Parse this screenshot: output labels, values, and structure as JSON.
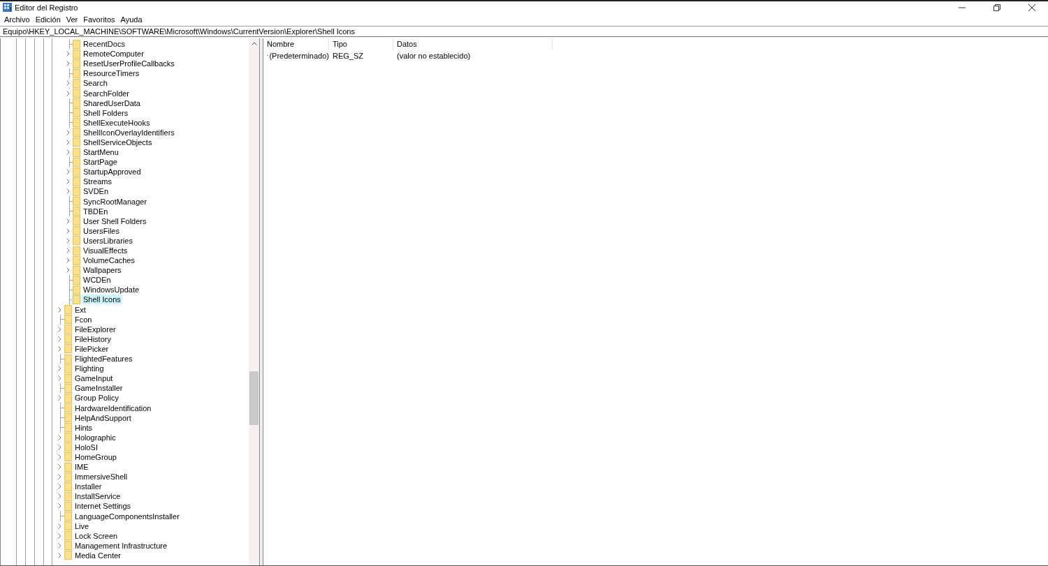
{
  "window": {
    "title": "Editor del Registro"
  },
  "menu": [
    "Archivo",
    "Edición",
    "Ver",
    "Favoritos",
    "Ayuda"
  ],
  "address": {
    "value": "Equipo\\HKEY_LOCAL_MACHINE\\SOFTWARE\\Microsoft\\Windows\\CurrentVersion\\Explorer\\Shell Icons"
  },
  "tree": {
    "items": [
      {
        "children": [
          {
            "label": "RecentDocs",
            "expandable": false,
            "selected": false
          },
          {
            "label": "RemoteComputer",
            "expandable": true,
            "selected": false
          },
          {
            "label": "ResetUserProfileCallbacks",
            "expandable": true,
            "selected": false
          },
          {
            "label": "ResourceTimers",
            "expandable": false,
            "selected": false
          },
          {
            "label": "Search",
            "expandable": true,
            "selected": false
          },
          {
            "label": "SearchFolder",
            "expandable": true,
            "selected": false
          },
          {
            "label": "SharedUserData",
            "expandable": false,
            "selected": false
          },
          {
            "label": "Shell Folders",
            "expandable": false,
            "selected": false
          },
          {
            "label": "ShellExecuteHooks",
            "expandable": false,
            "selected": false
          },
          {
            "label": "ShellIconOverlayIdentifiers",
            "expandable": true,
            "selected": false
          },
          {
            "label": "ShellServiceObjects",
            "expandable": true,
            "selected": false
          },
          {
            "label": "StartMenu",
            "expandable": true,
            "selected": false
          },
          {
            "label": "StartPage",
            "expandable": false,
            "selected": false
          },
          {
            "label": "StartupApproved",
            "expandable": true,
            "selected": false
          },
          {
            "label": "Streams",
            "expandable": true,
            "selected": false
          },
          {
            "label": "SVDEn",
            "expandable": true,
            "selected": false
          },
          {
            "label": "SyncRootManager",
            "expandable": false,
            "selected": false
          },
          {
            "label": "TBDEn",
            "expandable": false,
            "selected": false
          },
          {
            "label": "User Shell Folders",
            "expandable": true,
            "selected": false
          },
          {
            "label": "UsersFiles",
            "expandable": true,
            "selected": false
          },
          {
            "label": "UsersLibraries",
            "expandable": true,
            "selected": false
          },
          {
            "label": "VisualEffects",
            "expandable": true,
            "selected": false
          },
          {
            "label": "VolumeCaches",
            "expandable": true,
            "selected": false
          },
          {
            "label": "Wallpapers",
            "expandable": true,
            "selected": false
          },
          {
            "label": "WCDEn",
            "expandable": false,
            "selected": false
          },
          {
            "label": "WindowsUpdate",
            "expandable": false,
            "selected": false
          },
          {
            "label": "Shell Icons",
            "expandable": false,
            "selected": true
          }
        ]
      },
      {
        "label": "Ext",
        "expandable": true,
        "selected": false
      },
      {
        "label": "Fcon",
        "expandable": false,
        "selected": false
      },
      {
        "label": "FileExplorer",
        "expandable": true,
        "selected": false
      },
      {
        "label": "FileHistory",
        "expandable": true,
        "selected": false
      },
      {
        "label": "FilePicker",
        "expandable": true,
        "selected": false
      },
      {
        "label": "FlightedFeatures",
        "expandable": false,
        "selected": false
      },
      {
        "label": "Flighting",
        "expandable": true,
        "selected": false
      },
      {
        "label": "GameInput",
        "expandable": true,
        "selected": false
      },
      {
        "label": "GameInstaller",
        "expandable": false,
        "selected": false
      },
      {
        "label": "Group Policy",
        "expandable": true,
        "selected": false
      },
      {
        "label": "HardwareIdentification",
        "expandable": false,
        "selected": false
      },
      {
        "label": "HelpAndSupport",
        "expandable": false,
        "selected": false
      },
      {
        "label": "Hints",
        "expandable": false,
        "selected": false
      },
      {
        "label": "Holographic",
        "expandable": true,
        "selected": false
      },
      {
        "label": "HoloSI",
        "expandable": true,
        "selected": false
      },
      {
        "label": "HomeGroup",
        "expandable": true,
        "selected": false
      },
      {
        "label": "IME",
        "expandable": true,
        "selected": false
      },
      {
        "label": "ImmersiveShell",
        "expandable": true,
        "selected": false
      },
      {
        "label": "Installer",
        "expandable": true,
        "selected": false
      },
      {
        "label": "InstallService",
        "expandable": true,
        "selected": false
      },
      {
        "label": "Internet Settings",
        "expandable": true,
        "selected": false
      },
      {
        "label": "LanguageComponentsInstaller",
        "expandable": false,
        "selected": false
      },
      {
        "label": "Live",
        "expandable": true,
        "selected": false
      },
      {
        "label": "Lock Screen",
        "expandable": true,
        "selected": false
      },
      {
        "label": "Management Infrastructure",
        "expandable": true,
        "selected": false
      },
      {
        "label": "Media Center",
        "expandable": true,
        "selected": false
      }
    ]
  },
  "values": {
    "columns": [
      "Nombre",
      "Tipo",
      "Datos"
    ],
    "rows": [
      {
        "name": "(Predeterminado)",
        "type": "REG_SZ",
        "data": "(valor no establecido)"
      }
    ]
  }
}
